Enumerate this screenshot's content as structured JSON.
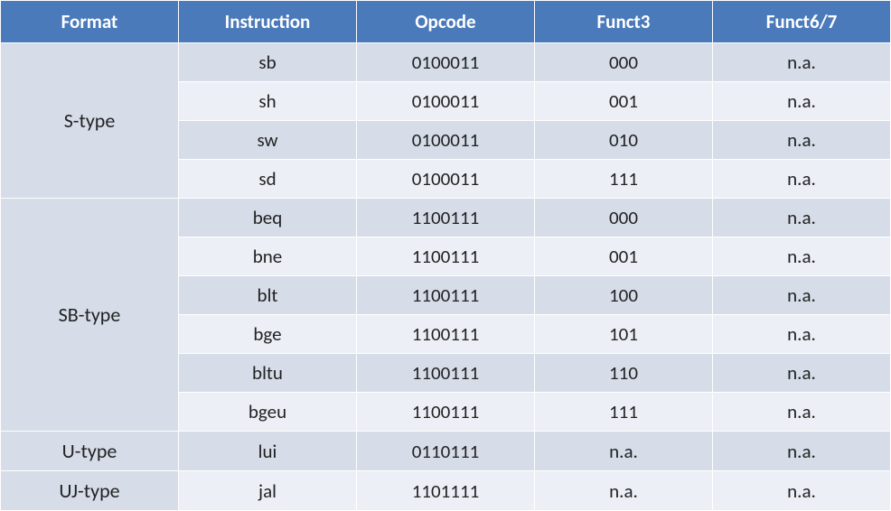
{
  "headers": {
    "c0": "Format",
    "c1": "Instruction",
    "c2": "Opcode",
    "c3": "Funct3",
    "c4": "Funct6/7"
  },
  "groups": {
    "g0": "S-type",
    "g1": "SB-type",
    "g2": "U-type",
    "g3": "UJ-type"
  },
  "rows": {
    "r0": {
      "instr": "sb",
      "opcode": "0100011",
      "funct3": "000",
      "funct67": "n.a."
    },
    "r1": {
      "instr": "sh",
      "opcode": "0100011",
      "funct3": "001",
      "funct67": "n.a."
    },
    "r2": {
      "instr": "sw",
      "opcode": "0100011",
      "funct3": "010",
      "funct67": "n.a."
    },
    "r3": {
      "instr": "sd",
      "opcode": "0100011",
      "funct3": "111",
      "funct67": "n.a."
    },
    "r4": {
      "instr": "beq",
      "opcode": "1100111",
      "funct3": "000",
      "funct67": "n.a."
    },
    "r5": {
      "instr": "bne",
      "opcode": "1100111",
      "funct3": "001",
      "funct67": "n.a."
    },
    "r6": {
      "instr": "blt",
      "opcode": "1100111",
      "funct3": "100",
      "funct67": "n.a."
    },
    "r7": {
      "instr": "bge",
      "opcode": "1100111",
      "funct3": "101",
      "funct67": "n.a."
    },
    "r8": {
      "instr": "bltu",
      "opcode": "1100111",
      "funct3": "110",
      "funct67": "n.a."
    },
    "r9": {
      "instr": "bgeu",
      "opcode": "1100111",
      "funct3": "111",
      "funct67": "n.a."
    },
    "r10": {
      "instr": "lui",
      "opcode": "0110111",
      "funct3": "n.a.",
      "funct67": "n.a."
    },
    "r11": {
      "instr": "jal",
      "opcode": "1101111",
      "funct3": "n.a.",
      "funct67": "n.a."
    }
  }
}
